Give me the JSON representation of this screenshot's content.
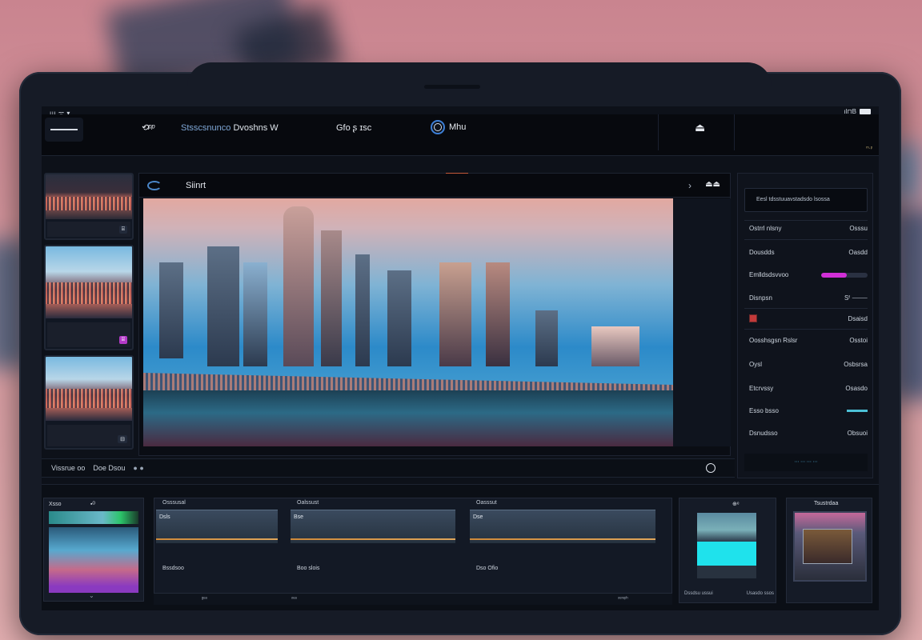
{
  "status": {
    "left": "ııı ᯤ ▾",
    "right": "ıl⊓B"
  },
  "topbar": {
    "logo": "⟲ᵖᵖ",
    "title_dim": "Stsscsnunco",
    "title": "Dvoshns W",
    "nav_item": "Gfo ʂ ɪsc",
    "mode_label": "Mhu",
    "extra": "ᵐ·ᵖ"
  },
  "preview": {
    "title": "Siinrt",
    "next_icon": "chevron-right-icon",
    "options_label": "⏏⏏"
  },
  "thumbnails": [
    {
      "badge": "⌸"
    },
    {
      "badge": "⌸"
    },
    {
      "badge": "⊟"
    }
  ],
  "transport": {
    "left_a": "Vissrue oo",
    "left_b": "Doe Dsou",
    "dots": "● ●"
  },
  "inspector": {
    "header": "Eesl tdsstuuavstadsdo lsossa",
    "rows": [
      {
        "label": "Ostrrl nlsny",
        "value": "Osssu"
      },
      {
        "label": "Dousdds",
        "value": "Oasdd"
      },
      {
        "label": "Emlldsdsvvoo",
        "slider": 0.55
      },
      {
        "label": "Disnpsn",
        "value": "Sᶠ ⸻"
      },
      {
        "label": "",
        "value": "Dsaisd"
      },
      {
        "label": "Oosshsgsn Rslsr",
        "value": "Osstoi"
      },
      {
        "label": "Oysl",
        "value": "Osbsrsa"
      },
      {
        "label": "Etcrvssy",
        "value": "Osasdo"
      },
      {
        "label": "Esso bsso",
        "value": ""
      },
      {
        "label": "Dsnudsso",
        "value": "Obsuoi"
      }
    ],
    "footer": "⋯ ⋯ ⋯ ⋯"
  },
  "timeline": {
    "left_clip": {
      "label": "Xsso",
      "label2": "▪ᴼ"
    },
    "tracks": [
      {
        "name": "Osssusal",
        "wave_label": "Dsls",
        "caption": "Bssdsoo"
      },
      {
        "name": "Oalssust",
        "wave_label": "Bse",
        "caption": "Boo slois"
      },
      {
        "name": "Oasssut",
        "wave_label": "Dse",
        "caption": "Dso Ofio"
      }
    ],
    "footer": [
      "ᵍᵉᵃ",
      "ᵒᵉᵃ",
      "ᵒᵉʳᵉᵖʰ"
    ],
    "panel_a": {
      "header": "⊕ᵉ",
      "foot_left": "Dssdsu ussui",
      "foot_right": "Usasdo ssos"
    },
    "panel_b": {
      "header": "Tsustrdaa"
    }
  }
}
